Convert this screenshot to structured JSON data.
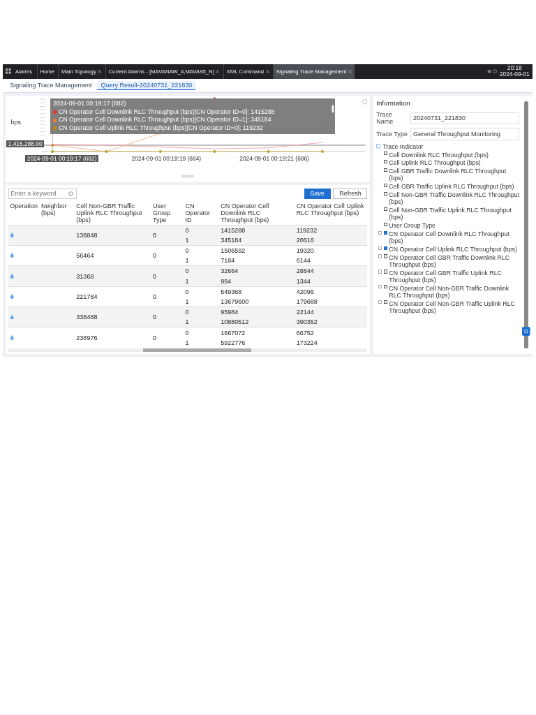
{
  "top_bar": {
    "menu": "Alarms",
    "tabs": [
      {
        "label": "Home",
        "selected": false,
        "closable": false
      },
      {
        "label": "Main Topology",
        "selected": false,
        "closable": true
      },
      {
        "label": "Current Alarms - [MAVANAW_4,MAVA95_N]",
        "selected": false,
        "closable": true
      },
      {
        "label": "XML Command",
        "selected": false,
        "closable": true
      },
      {
        "label": "Signaling Trace Management",
        "selected": true,
        "closable": true
      }
    ],
    "time": "20:18",
    "date": "2024-09-01"
  },
  "sub_tabs": [
    {
      "label": "Signaling Trace Management",
      "selected": false
    },
    {
      "label": "Query Result-20240731_221830",
      "selected": true
    }
  ],
  "chart": {
    "y_axis_label": "bps",
    "crosshair_value": "1,415,288.00",
    "x_labels": [
      "2024-09-01 00:19:17 (682)",
      "2024-09-01 00:19:19 (684)",
      "2024-09-01 00:19:21 (686)"
    ],
    "tooltip": {
      "title": "2024-09-01 00:19:17 (682)",
      "items": [
        {
          "text": "CN Operator Cell Downlink RLC Throughput (bps)[CN Operator ID=0]: 1415288",
          "color": "#e53935"
        },
        {
          "text": "CN Operator Cell Downlink RLC Throughput (bps)[CN Operator ID=1]: 345184",
          "color": "#f07c30"
        },
        {
          "text": "CN Operator Cell Uplink RLC Throughput (bps)[CN Operator ID=0]: 119232",
          "color": "#b8860b"
        }
      ]
    }
  },
  "toolbar": {
    "search_placeholder": "Enter a keyword",
    "buttons": [
      {
        "label": "Save",
        "primary": true
      },
      {
        "label": "Refresh",
        "primary": false
      }
    ]
  },
  "table": {
    "columns": [
      "Operation",
      "Neighbor (bps)",
      "Cell Non-GBR Traffic Uplink RLC Throughput (bps)",
      "User Group Type",
      "CN Operator ID",
      "CN Operator Cell Downlink RLC Throughput (bps)",
      "CN Operator Cell Uplink RLC Throughput (bps)"
    ],
    "rows": [
      {
        "non_gbr": "138848",
        "user_group": "0",
        "sub": [
          [
            "0",
            "1415288",
            "119232"
          ],
          [
            "1",
            "345184",
            "20616"
          ]
        ]
      },
      {
        "non_gbr": "56464",
        "user_group": "0",
        "sub": [
          [
            "0",
            "1506592",
            "19320"
          ],
          [
            "1",
            "7184",
            "6144"
          ]
        ]
      },
      {
        "non_gbr": "31368",
        "user_group": "0",
        "sub": [
          [
            "0",
            "32664",
            "28844"
          ],
          [
            "1",
            "994",
            "1344"
          ]
        ]
      },
      {
        "non_gbr": "221784",
        "user_group": "0",
        "sub": [
          [
            "0",
            "549368",
            "42096"
          ],
          [
            "1",
            "13679600",
            "179688"
          ]
        ]
      },
      {
        "non_gbr": "338488",
        "user_group": "0",
        "sub": [
          [
            "0",
            "95984",
            "22144"
          ],
          [
            "1",
            "10880512",
            "390352"
          ]
        ]
      },
      {
        "non_gbr": "238976",
        "user_group": "0",
        "sub": [
          [
            "0",
            "1667072",
            "66752"
          ],
          [
            "1",
            "5922776",
            "173224"
          ]
        ]
      }
    ]
  },
  "information": {
    "title": "Information",
    "fields": [
      {
        "label": "Trace Name",
        "value": "20240731_221830"
      },
      {
        "label": "Trace Type",
        "value": "General Throughput Monitoring"
      }
    ],
    "indicator_title": "Trace Indicator",
    "indicators": [
      {
        "label": "Cell Downlink RLC Throughput (bps)",
        "checked": false,
        "expandable": false
      },
      {
        "label": "Cell Uplink RLC Throughput (bps)",
        "checked": false,
        "expandable": false
      },
      {
        "label": "Cell GBR Traffic Downlink RLC Throughput (bps)",
        "checked": false,
        "expandable": false
      },
      {
        "label": "Cell GBR Traffic Uplink RLC Throughput (bps)",
        "checked": false,
        "expandable": false
      },
      {
        "label": "Cell Non-GBR Traffic Downlink RLC Throughput (bps)",
        "checked": false,
        "expandable": false
      },
      {
        "label": "Cell Non-GBR Traffic Uplink RLC Throughput (bps)",
        "checked": false,
        "expandable": false
      },
      {
        "label": "User Group Type",
        "checked": false,
        "expandable": false
      },
      {
        "label": "CN Operator Cell Downlink RLC Throughput (bps)",
        "checked": true,
        "expandable": true
      },
      {
        "label": "CN Operator Cell Uplink RLC Throughput (bps)",
        "checked": true,
        "expandable": true
      },
      {
        "label": "CN Operator Cell GBR Traffic Downlink RLC Throughput (bps)",
        "checked": false,
        "expandable": true
      },
      {
        "label": "CN Operator Cell GBR Traffic Uplink RLC Throughput (bps)",
        "checked": false,
        "expandable": true
      },
      {
        "label": "CN Operator Cell Non-GBR Traffic Downlink RLC Throughput (bps)",
        "checked": false,
        "expandable": true
      },
      {
        "label": "CN Operator Cell Non-GBR Traffic Uplink RLC Throughput (bps)",
        "checked": false,
        "expandable": true
      }
    ]
  }
}
